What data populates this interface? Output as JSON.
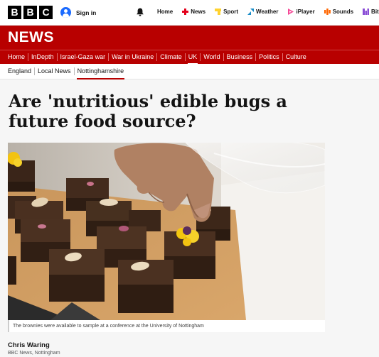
{
  "brand": {
    "logo_letters": [
      "B",
      "B",
      "C"
    ],
    "accent": "#b80000"
  },
  "header": {
    "signin_label": "Sign in",
    "nav": [
      {
        "label": "Home",
        "icon": "home",
        "color": "#141414"
      },
      {
        "label": "News",
        "icon": "news-icon",
        "color": "#e3001b"
      },
      {
        "label": "Sport",
        "icon": "sport-icon",
        "color": "#ffd230"
      },
      {
        "label": "Weather",
        "icon": "weather-icon",
        "color": "#1a8dc8"
      },
      {
        "label": "iPlayer",
        "icon": "iplayer-icon",
        "color": "#f54997"
      },
      {
        "label": "Sounds",
        "icon": "sounds-icon",
        "color": "#ff6600"
      },
      {
        "label": "Bit",
        "icon": "bitesize-icon",
        "color": "#8a4dd6"
      }
    ]
  },
  "banner": {
    "title": "NEWS"
  },
  "sections": {
    "items": [
      "Home",
      "InDepth",
      "Israel-Gaza war",
      "War in Ukraine",
      "Climate",
      "UK",
      "World",
      "Business",
      "Politics",
      "Culture"
    ],
    "active": "UK"
  },
  "subsections": {
    "items": [
      "England",
      "Local News",
      "Nottinghamshire"
    ],
    "active": "Nottinghamshire"
  },
  "article": {
    "headline": "Are 'nutritious' edible bugs a future food source?",
    "image_caption": "The brownies were available to sample at a conference at the University of Nottingham",
    "author_name": "Chris Waring",
    "author_org": "BBC News, Nottingham"
  }
}
